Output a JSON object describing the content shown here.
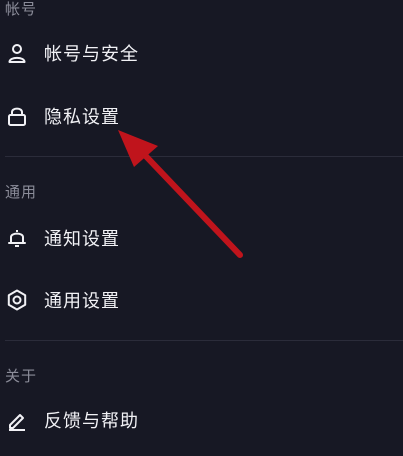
{
  "sections": [
    {
      "header": "帐号",
      "items": [
        {
          "label": "帐号与安全",
          "icon": "person-icon"
        },
        {
          "label": "隐私设置",
          "icon": "lock-icon"
        }
      ]
    },
    {
      "header": "通用",
      "items": [
        {
          "label": "通知设置",
          "icon": "bell-icon"
        },
        {
          "label": "通用设置",
          "icon": "gear-icon"
        }
      ]
    },
    {
      "header": "关于",
      "items": [
        {
          "label": "反馈与帮助",
          "icon": "edit-icon"
        }
      ]
    }
  ],
  "colors": {
    "background": "#171824",
    "text": "#f1f1f5",
    "section_header": "#8b8c99",
    "divider": "#2b2c3a",
    "annotation_arrow": "#c0141c"
  }
}
